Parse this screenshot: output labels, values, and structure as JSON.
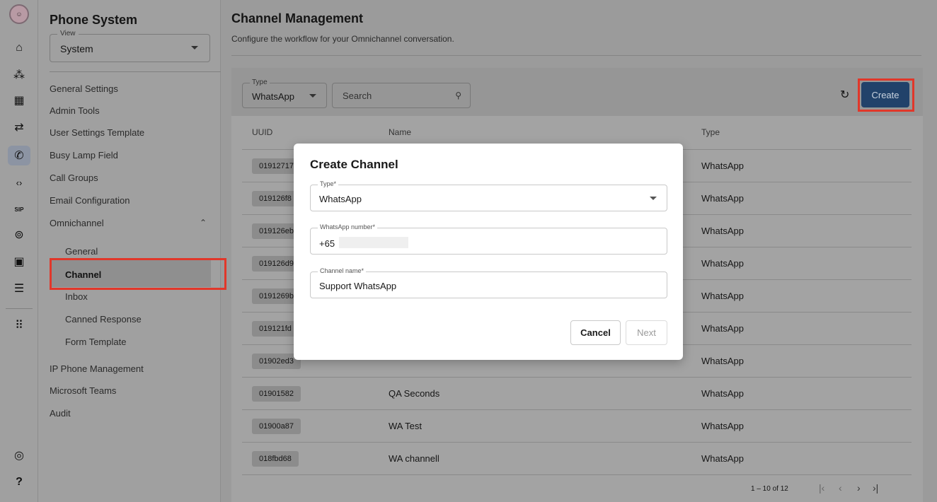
{
  "rail": {
    "items": [
      {
        "icon": "home-icon",
        "glyph": "⌂"
      },
      {
        "icon": "organization-icon",
        "glyph": "⁂"
      },
      {
        "icon": "dashboard-icon",
        "glyph": "▦"
      },
      {
        "icon": "transfer-icon",
        "glyph": "⇄"
      },
      {
        "icon": "phone-icon",
        "glyph": "✆"
      },
      {
        "icon": "code-icon",
        "glyph": "‹›"
      },
      {
        "icon": "sip-icon",
        "glyph": "SIP"
      },
      {
        "icon": "broadcast-icon",
        "glyph": "⊚"
      },
      {
        "icon": "contacts-icon",
        "glyph": "▣"
      },
      {
        "icon": "storage-icon",
        "glyph": "☰"
      },
      {
        "icon": "apps-grid-icon",
        "glyph": "⠿"
      },
      {
        "icon": "podcast-icon",
        "glyph": "◎"
      },
      {
        "icon": "help-icon",
        "glyph": "?"
      }
    ]
  },
  "sidebar": {
    "title": "Phone System",
    "view": {
      "label": "View",
      "value": "System"
    },
    "menu": [
      "General Settings",
      "Admin Tools",
      "User Settings Template",
      "Busy Lamp Field",
      "Call Groups",
      "Email Configuration",
      "Omnichannel"
    ],
    "omnichannel_sub": [
      "General",
      "Channel",
      "Inbox",
      "Canned Response",
      "Form Template"
    ],
    "menu_bottom": [
      "IP Phone Management",
      "Microsoft Teams",
      "Audit"
    ]
  },
  "main": {
    "title": "Channel Management",
    "subtitle": "Configure the workflow for your Omnichannel conversation.",
    "toolbar": {
      "type_label": "Type",
      "type_value": "WhatsApp",
      "search_placeholder": "Search",
      "create_label": "Create"
    },
    "table": {
      "headers": [
        "UUID",
        "Name",
        "Type"
      ],
      "rows": [
        {
          "uuid": "01912717",
          "name": "",
          "type": "WhatsApp"
        },
        {
          "uuid": "019126f8",
          "name": "",
          "type": "WhatsApp"
        },
        {
          "uuid": "019126eb",
          "name": "",
          "type": "WhatsApp"
        },
        {
          "uuid": "019126d9",
          "name": "",
          "type": "WhatsApp"
        },
        {
          "uuid": "0191269b",
          "name": "",
          "type": "WhatsApp"
        },
        {
          "uuid": "019121fd",
          "name": "",
          "type": "WhatsApp"
        },
        {
          "uuid": "01902ed3",
          "name": "",
          "type": "WhatsApp"
        },
        {
          "uuid": "01901582",
          "name": "QA Seconds",
          "type": "WhatsApp"
        },
        {
          "uuid": "01900a87",
          "name": "WA Test",
          "type": "WhatsApp"
        },
        {
          "uuid": "018fbd68",
          "name": "WA channell",
          "type": "WhatsApp"
        }
      ]
    },
    "pagination": {
      "range": "1 – 10 of 12"
    }
  },
  "modal": {
    "title": "Create Channel",
    "type": {
      "label": "Type*",
      "value": "WhatsApp"
    },
    "number": {
      "label": "WhatsApp number*",
      "value": "+65"
    },
    "channel_name": {
      "label": "Channel name*",
      "value": "Support WhatsApp"
    },
    "cancel_label": "Cancel",
    "next_label": "Next"
  }
}
